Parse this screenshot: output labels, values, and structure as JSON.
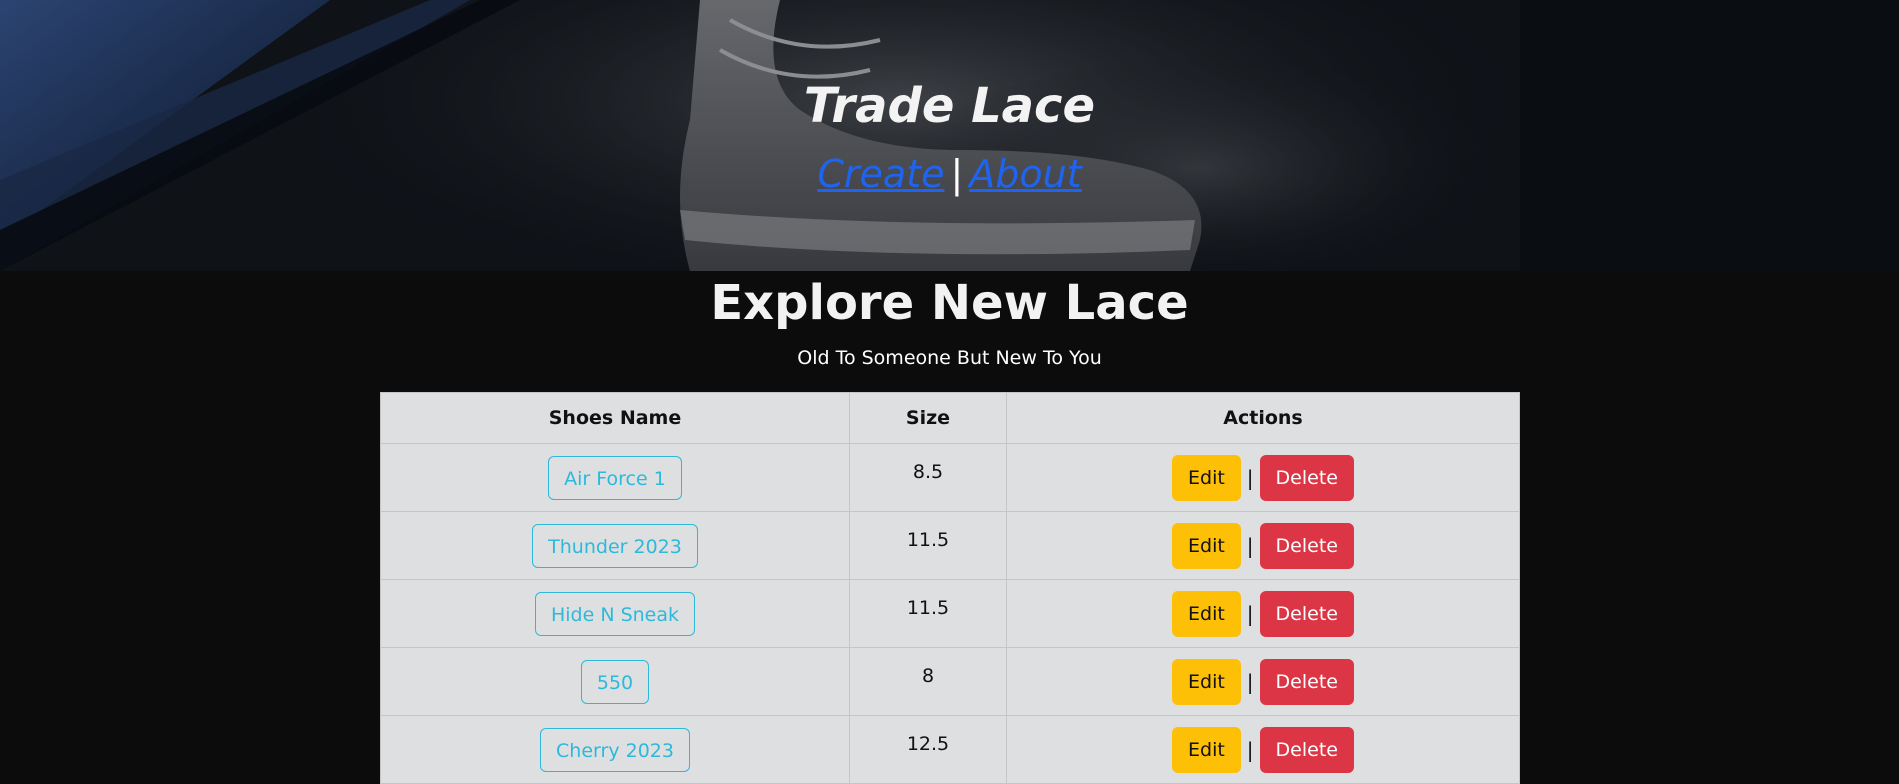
{
  "header": {
    "title": "Trade Lace",
    "nav": {
      "create_label": "Create",
      "separator": "|",
      "about_label": "About"
    }
  },
  "main": {
    "title": "Explore New Lace",
    "subtitle": "Old To Someone But New To You"
  },
  "table": {
    "columns": [
      "Shoes Name",
      "Size",
      "Actions"
    ],
    "rows": [
      {
        "name": "Air Force 1",
        "size": "8.5"
      },
      {
        "name": "Thunder 2023",
        "size": "11.5"
      },
      {
        "name": "Hide N Sneak",
        "size": "11.5"
      },
      {
        "name": "550",
        "size": "8"
      },
      {
        "name": "Cherry 2023",
        "size": "12.5"
      }
    ],
    "edit_label": "Edit",
    "separator": "|",
    "delete_label": "Delete"
  },
  "colors": {
    "background": "#0c0c0c",
    "link": "#1f64f0",
    "name_button": "#2cb9db",
    "edit_button": "#fec007",
    "delete_button": "#dc3545"
  }
}
